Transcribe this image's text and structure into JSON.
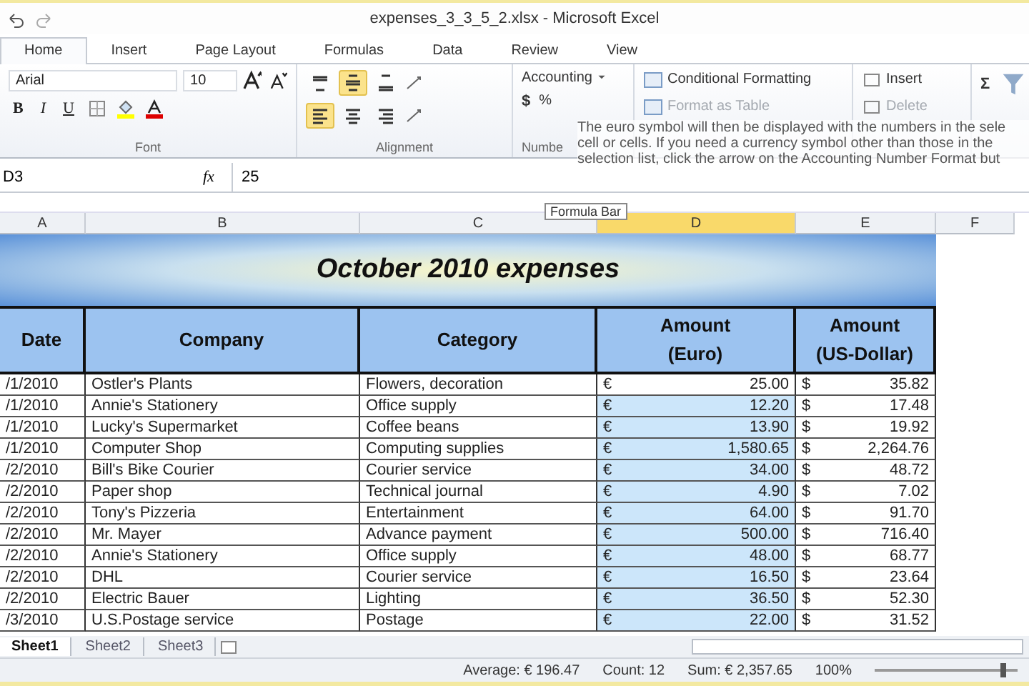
{
  "window": {
    "title": "expenses_3_3_5_2.xlsx - Microsoft Excel"
  },
  "tabs": [
    {
      "label": "Home",
      "selected": true
    },
    {
      "label": "Insert",
      "selected": false
    },
    {
      "label": "Page Layout",
      "selected": false
    },
    {
      "label": "Formulas",
      "selected": false
    },
    {
      "label": "Data",
      "selected": false
    },
    {
      "label": "Review",
      "selected": false
    },
    {
      "label": "View",
      "selected": false
    }
  ],
  "ribbon": {
    "font": {
      "name": "Arial",
      "size": "10",
      "bold": "B",
      "italic": "I",
      "underline": "U",
      "label": "Font"
    },
    "alignment": {
      "label": "Alignment",
      "buttons": [
        {
          "kind": "top",
          "selected": false
        },
        {
          "kind": "middle",
          "selected": true
        },
        {
          "kind": "bottom",
          "selected": false
        },
        {
          "kind": "left",
          "selected": true
        },
        {
          "kind": "center",
          "selected": false
        },
        {
          "kind": "right",
          "selected": false
        }
      ]
    },
    "number": {
      "format": "Accounting",
      "currency": "$",
      "percent": "%",
      "label": "Numbe"
    },
    "styles": [
      {
        "label": "Conditional Formatting",
        "disabled": false
      },
      {
        "label": "Format as Table",
        "disabled": true
      }
    ],
    "cells": [
      {
        "label": "Insert",
        "disabled": false
      },
      {
        "label": "Delete",
        "disabled": true
      }
    ],
    "editing": {
      "sum": "Σ"
    }
  },
  "caption": "The euro symbol will then be displayed with the numbers in the sele cell or cells. If you need a currency symbol other than those in the selection list, click the arrow on the Accounting Number Format but",
  "formula_bar": {
    "name_box": "D3",
    "fx": "fx",
    "value": "25",
    "tooltip": "Formula Bar"
  },
  "columns": [
    {
      "label": "A",
      "selected": false
    },
    {
      "label": "B",
      "selected": false
    },
    {
      "label": "C",
      "selected": false
    },
    {
      "label": "D",
      "selected": true
    },
    {
      "label": "E",
      "selected": false
    },
    {
      "label": "F",
      "selected": false
    }
  ],
  "sheet": {
    "title": "October 2010 expenses",
    "headers": [
      [
        "Date"
      ],
      [
        "Company"
      ],
      [
        "Category"
      ],
      [
        "Amount",
        "(Euro)"
      ],
      [
        "Amount",
        "(US-Dollar)"
      ]
    ],
    "rows": [
      {
        "date": "/1/2010",
        "company": "Ostler's Plants",
        "category": "Flowers, decoration",
        "euro": "25.00",
        "usd": "35.82",
        "selected": false
      },
      {
        "date": "/1/2010",
        "company": "Annie's Stationery",
        "category": "Office supply",
        "euro": "12.20",
        "usd": "17.48",
        "selected": true
      },
      {
        "date": "/1/2010",
        "company": "Lucky's Supermarket",
        "category": "Coffee beans",
        "euro": "13.90",
        "usd": "19.92",
        "selected": true
      },
      {
        "date": "/1/2010",
        "company": "Computer Shop",
        "category": "Computing supplies",
        "euro": "1,580.65",
        "usd": "2,264.76",
        "selected": true
      },
      {
        "date": "/2/2010",
        "company": "Bill's Bike Courier",
        "category": "Courier service",
        "euro": "34.00",
        "usd": "48.72",
        "selected": true
      },
      {
        "date": "/2/2010",
        "company": "Paper shop",
        "category": "Technical journal",
        "euro": "4.90",
        "usd": "7.02",
        "selected": true
      },
      {
        "date": "/2/2010",
        "company": "Tony's Pizzeria",
        "category": "Entertainment",
        "euro": "64.00",
        "usd": "91.70",
        "selected": true
      },
      {
        "date": "/2/2010",
        "company": "Mr. Mayer",
        "category": "Advance payment",
        "euro": "500.00",
        "usd": "716.40",
        "selected": true
      },
      {
        "date": "/2/2010",
        "company": "Annie's Stationery",
        "category": "Office supply",
        "euro": "48.00",
        "usd": "68.77",
        "selected": true
      },
      {
        "date": "/2/2010",
        "company": "DHL",
        "category": "Courier service",
        "euro": "16.50",
        "usd": "23.64",
        "selected": true
      },
      {
        "date": "/2/2010",
        "company": "Electric Bauer",
        "category": "Lighting",
        "euro": "36.50",
        "usd": "52.30",
        "selected": true
      },
      {
        "date": "/3/2010",
        "company": "U.S.Postage service",
        "category": "Postage",
        "euro": "22.00",
        "usd": "31.52",
        "selected": true
      }
    ],
    "euro_symbol": "€",
    "usd_symbol": "$"
  },
  "sheet_tabs": [
    {
      "label": "Sheet1",
      "selected": true
    },
    {
      "label": "Sheet2",
      "selected": false
    },
    {
      "label": "Sheet3",
      "selected": false
    }
  ],
  "status_bar": {
    "average": "Average: € 196.47",
    "count": "Count: 12",
    "sum": "Sum: € 2,357.65",
    "zoom": "100%",
    "zoom_slider": {
      "level": 0.9
    }
  }
}
